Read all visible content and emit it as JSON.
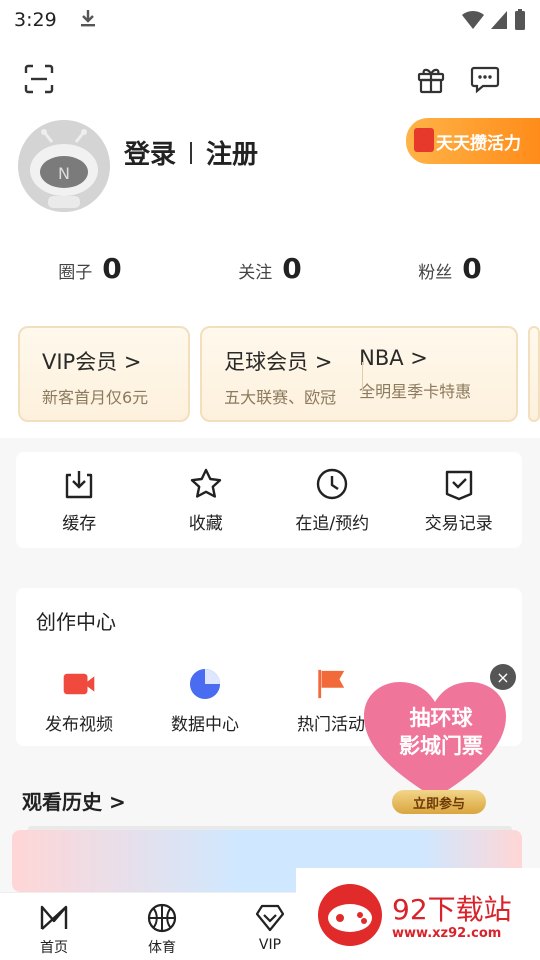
{
  "status_bar": {
    "time": "3:29"
  },
  "profile": {
    "login": "登录",
    "register": "注册",
    "energy_badge": "天天攒活力"
  },
  "stats": [
    {
      "label": "圈子",
      "value": "0"
    },
    {
      "label": "关注",
      "value": "0"
    },
    {
      "label": "粉丝",
      "value": "0"
    }
  ],
  "vip_cards": [
    {
      "title": "VIP会员 >",
      "subtitle": "新客首月仅6元"
    },
    {
      "title": "足球会员 >",
      "subtitle": "五大联赛、欧冠"
    },
    {
      "title": "NBA >",
      "subtitle": "全明星季卡特惠"
    }
  ],
  "quick_actions": [
    {
      "label": "缓存",
      "icon": "download-icon"
    },
    {
      "label": "收藏",
      "icon": "star-icon"
    },
    {
      "label": "在追/预约",
      "icon": "clock-icon"
    },
    {
      "label": "交易记录",
      "icon": "receipt-icon"
    }
  ],
  "creator": {
    "title": "创作中心",
    "items": [
      {
        "label": "发布视频",
        "icon": "video-camera-icon",
        "color": "#f04a3e"
      },
      {
        "label": "数据中心",
        "icon": "pie-chart-icon",
        "color": "#4a6cf0"
      },
      {
        "label": "热门活动",
        "icon": "flag-icon",
        "color": "#f36a3a"
      }
    ]
  },
  "history": {
    "title": "观看历史 >"
  },
  "popup": {
    "line1": "抽环球",
    "line2": "影城门票",
    "button": "立即参与",
    "close": "×"
  },
  "tabbar": [
    {
      "label": "首页",
      "icon": "home-logo-icon"
    },
    {
      "label": "体育",
      "icon": "basketball-icon"
    },
    {
      "label": "VIP",
      "icon": "vip-diamond-icon"
    }
  ],
  "watermark": {
    "name": "92下载站",
    "url": "www.xz92.com"
  },
  "colors": {
    "accent": "#ff8c1a",
    "vip_card_bg": "#fdf1dd",
    "watermark_red": "#d8232a"
  }
}
